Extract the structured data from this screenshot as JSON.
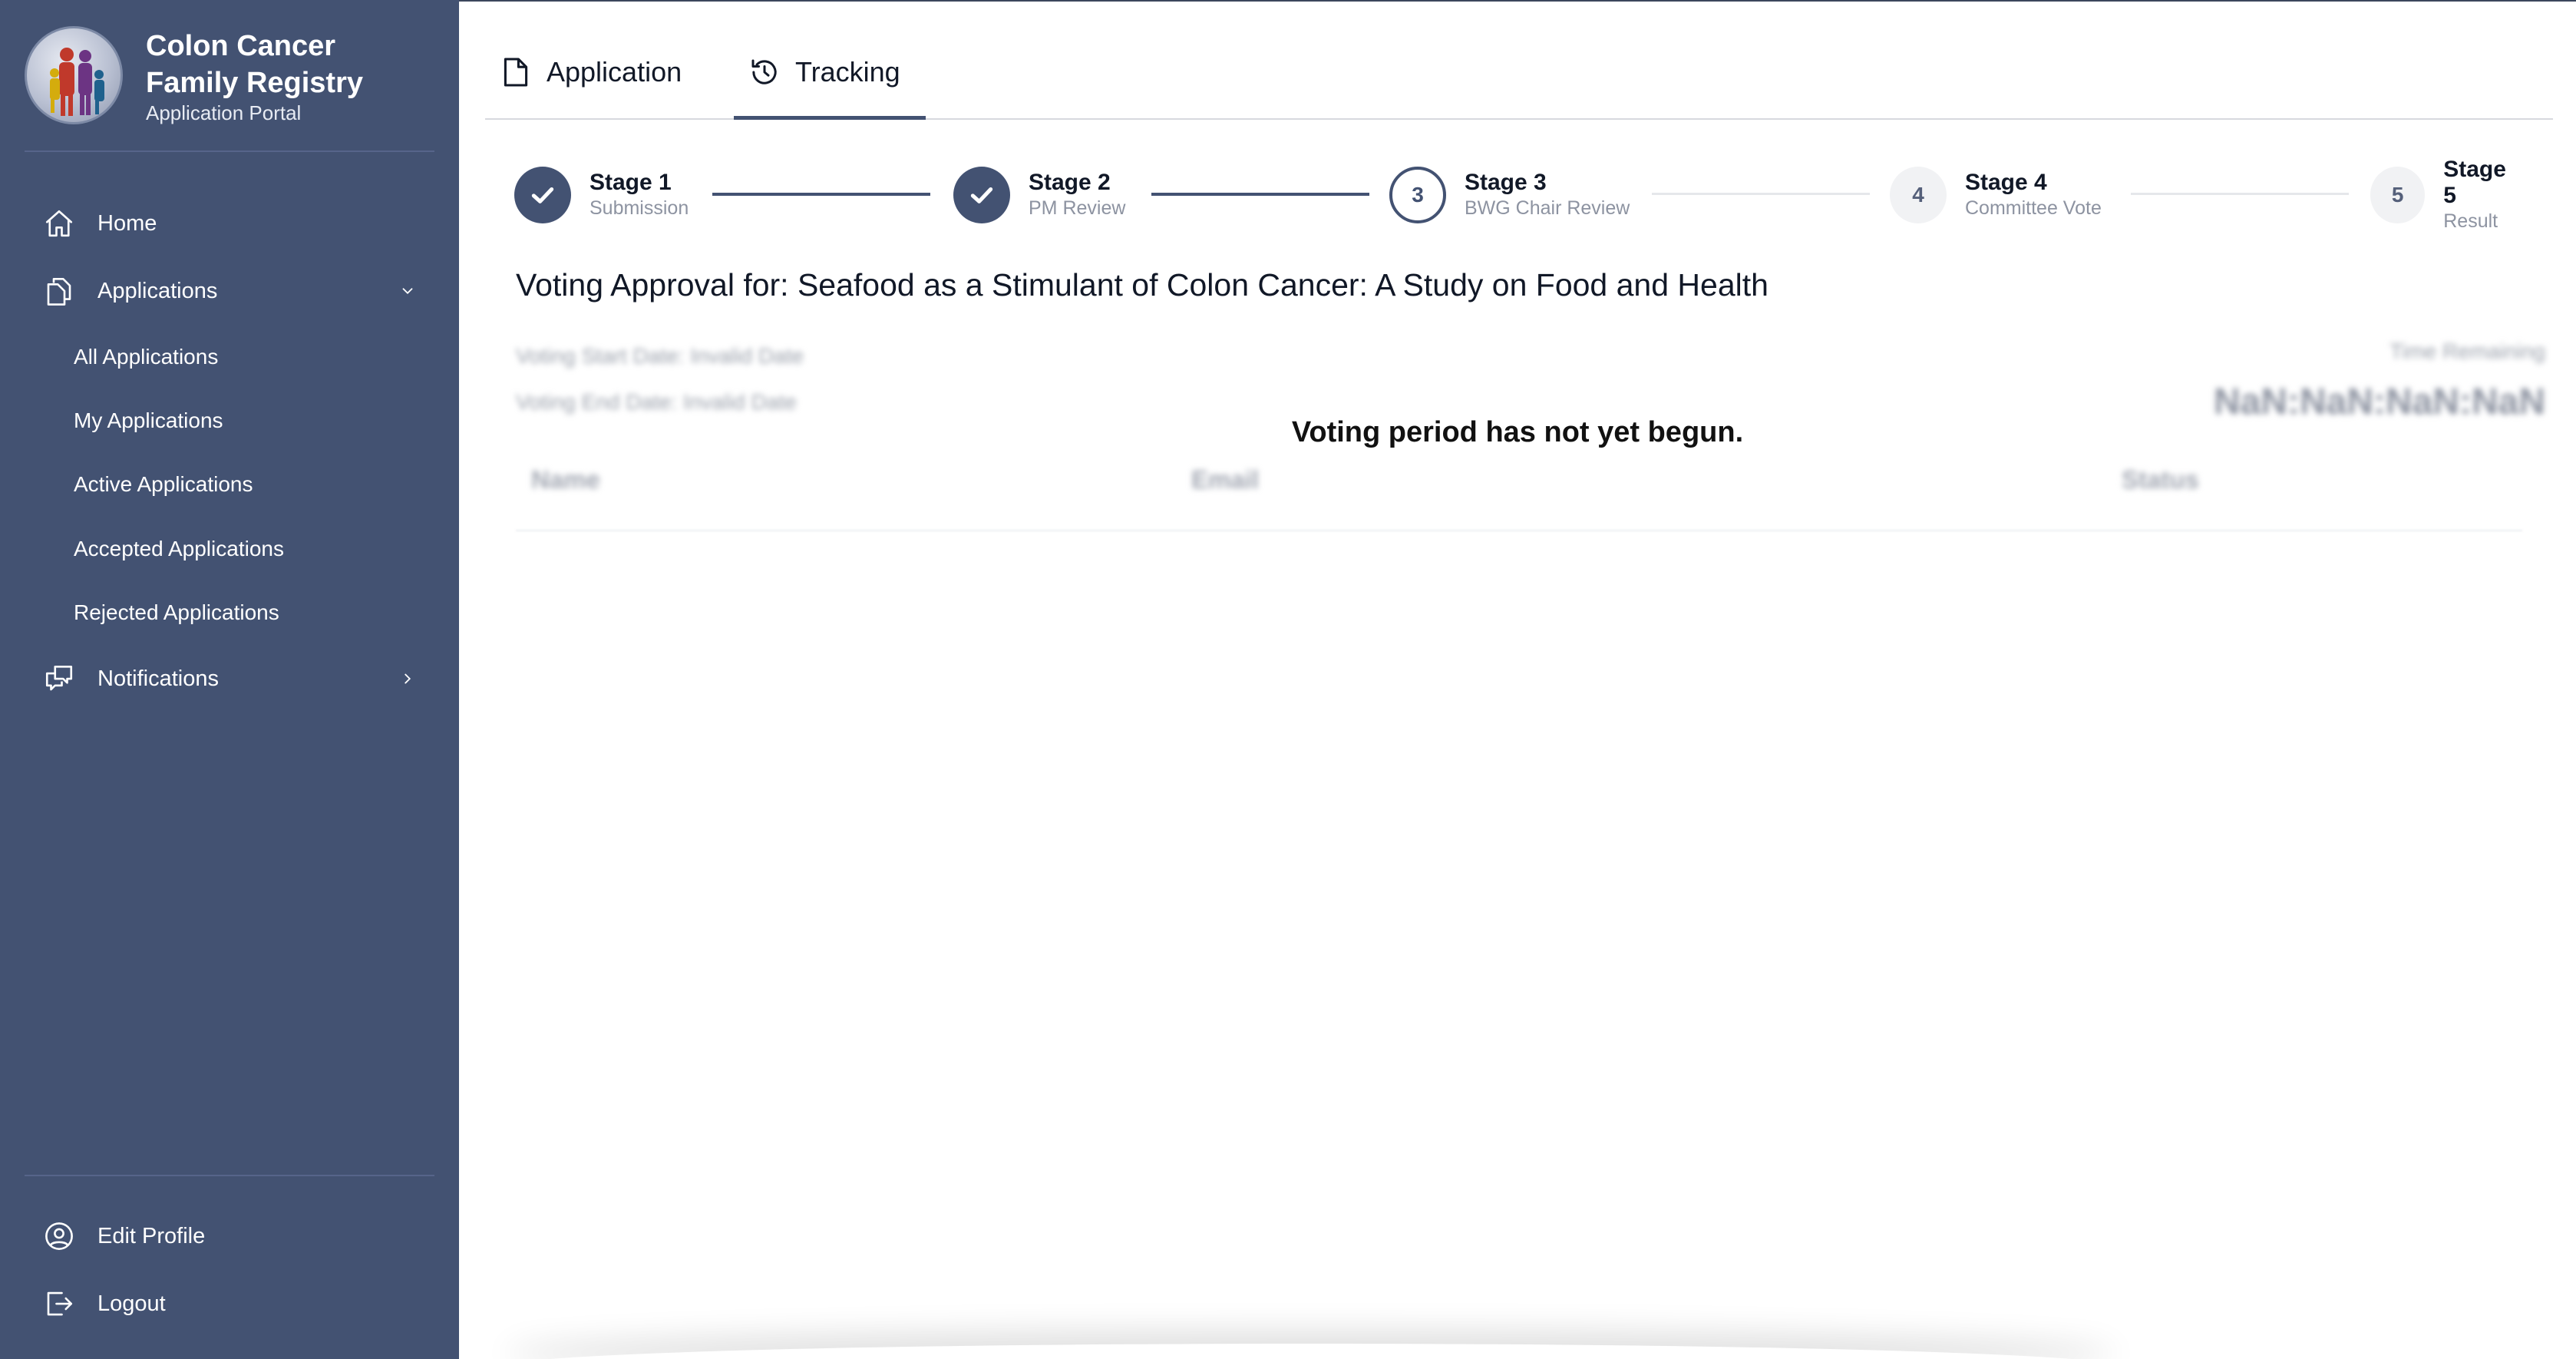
{
  "brand": {
    "title": "Colon Cancer Family Registry",
    "subtitle": "Application Portal"
  },
  "sidebar": {
    "home": "Home",
    "applications": "Applications",
    "sub_items": [
      "All Applications",
      "My Applications",
      "Active Applications",
      "Accepted Applications",
      "Rejected Applications"
    ],
    "notifications": "Notifications",
    "edit_profile": "Edit Profile",
    "logout": "Logout"
  },
  "tabs": [
    {
      "label": "Application",
      "icon": "document-icon",
      "active": false
    },
    {
      "label": "Tracking",
      "icon": "history-icon",
      "active": true
    }
  ],
  "stepper": [
    {
      "title": "Stage 1",
      "subtitle": "Submission",
      "state": "done",
      "number": "1"
    },
    {
      "title": "Stage 2",
      "subtitle": "PM Review",
      "state": "done",
      "number": "2"
    },
    {
      "title": "Stage 3",
      "subtitle": "BWG Chair Review",
      "state": "current",
      "number": "3"
    },
    {
      "title": "Stage 4",
      "subtitle": "Committee Vote",
      "state": "pending",
      "number": "4"
    },
    {
      "title": "Stage 5",
      "subtitle": "Result",
      "state": "pending",
      "number": "5"
    }
  ],
  "main": {
    "title": "Voting Approval for: Seafood as a Stimulant of Colon Cancer: A Study on Food and Health",
    "voting_start": "Voting Start Date: Invalid Date",
    "voting_end": "Voting End Date: Invalid Date",
    "time_remaining_label": "Time Remaining",
    "time_remaining_value": "NaN:NaN:NaN:NaN",
    "columns": [
      "Name",
      "Email",
      "Status"
    ],
    "message": "Voting period has not yet begun."
  },
  "colors": {
    "sidebar_bg": "#435272",
    "accent": "#435272",
    "pending_step_bg": "#f1f2f4"
  }
}
